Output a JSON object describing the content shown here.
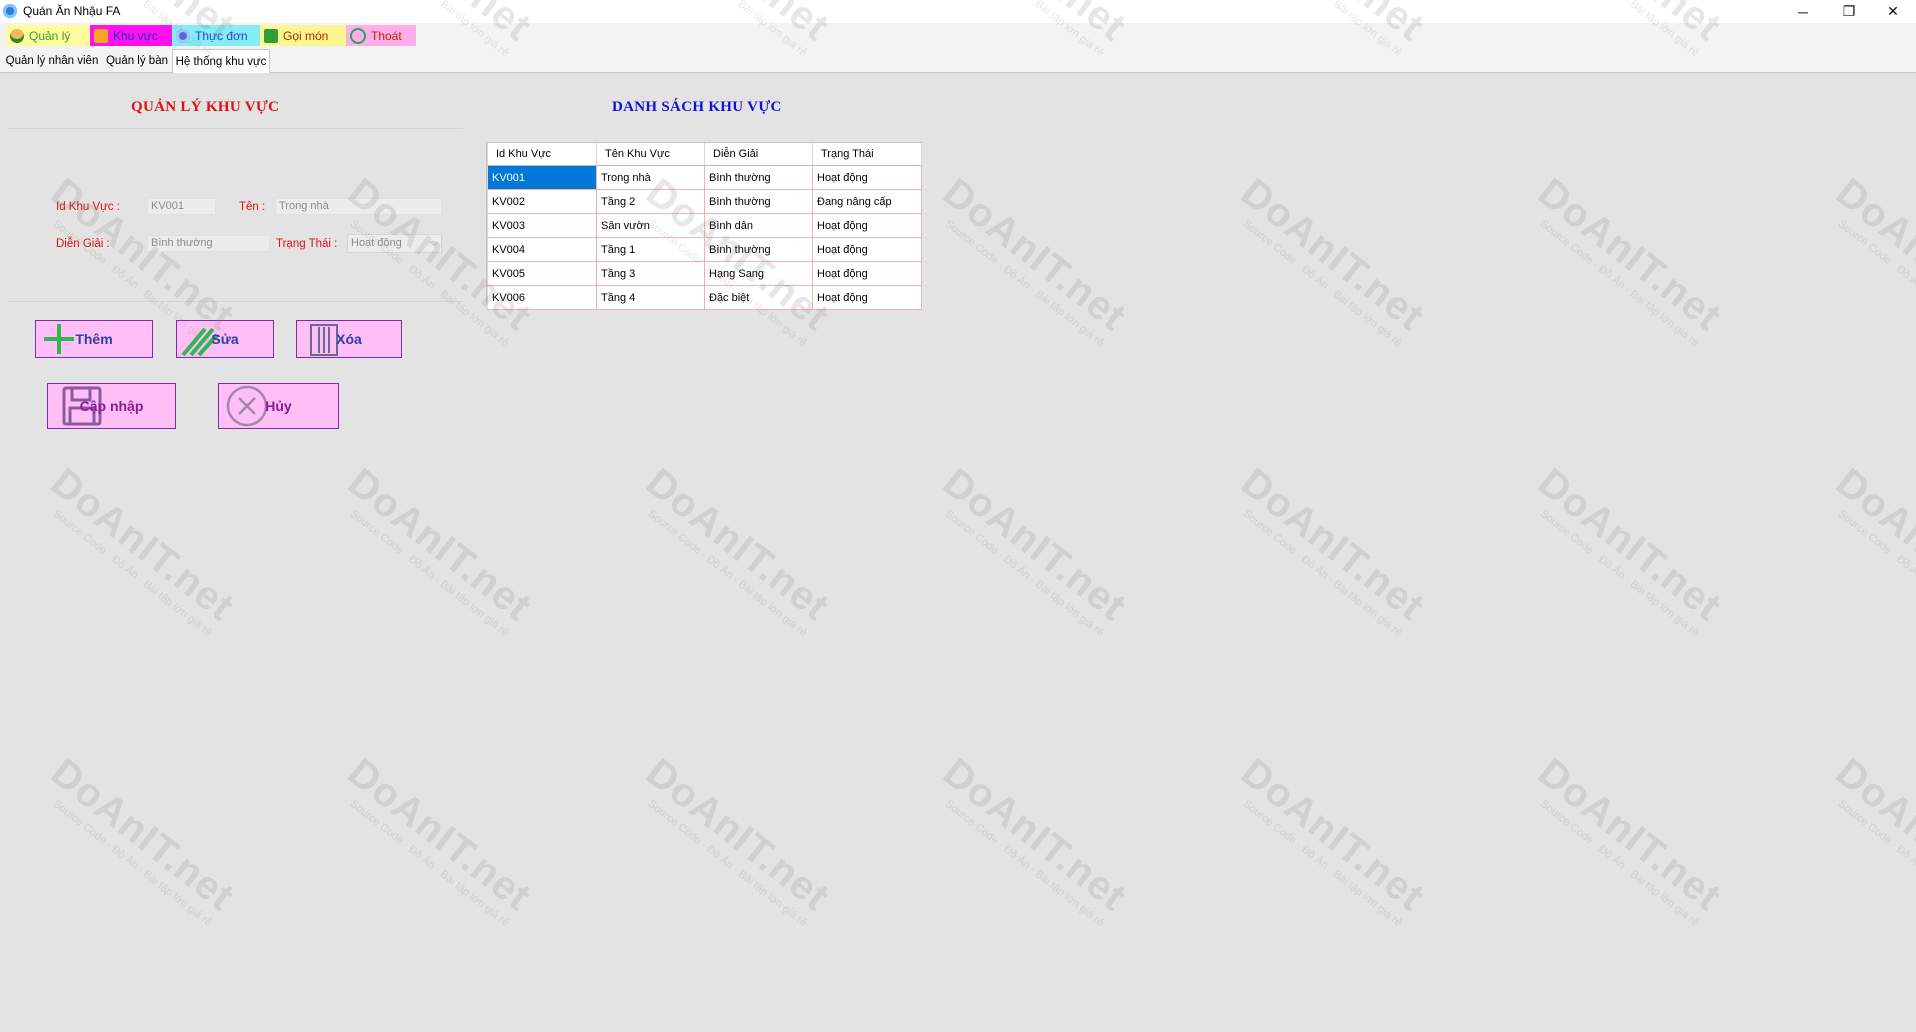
{
  "window": {
    "title": "Quán Ăn Nhậu FA",
    "minimize_glyph": "─",
    "maximize_glyph": "❐",
    "close_glyph": "✕"
  },
  "menu": [
    {
      "label": "Quản lý",
      "icon": "user-icon"
    },
    {
      "label": "Khu vực",
      "icon": "building-icon"
    },
    {
      "label": "Thực đơn",
      "icon": "menu-book-icon"
    },
    {
      "label": "Gọi món",
      "icon": "order-icon"
    },
    {
      "label": "Thoát",
      "icon": "power-icon"
    }
  ],
  "tabs": [
    "Quản lý nhân viên",
    "Quản lý bàn",
    "Hệ thống khu vực"
  ],
  "left_heading": "QUẢN LÝ  KHU VỰC",
  "right_heading": "DANH SÁCH KHU VỰC",
  "form": {
    "id_label": "Id Khu Vực :",
    "id_value": "KV001",
    "name_label": "Tên :",
    "name_value": "Trong nhà",
    "desc_label": "Diễn Giải :",
    "desc_value": "Bình thường",
    "status_label": "Trạng Thái :",
    "status_value": "Hoạt động"
  },
  "buttons": {
    "add": "Thêm",
    "edit": "Sửa",
    "delete": "Xóa",
    "update": "Cập nhập",
    "cancel": "Hủy"
  },
  "grid": {
    "columns": [
      "Id Khu Vực",
      "Tên Khu Vực",
      "Diễn Giải",
      "Trạng Thái"
    ],
    "rows": [
      [
        "KV001",
        "Trong nhà",
        "Bình thường",
        "Hoạt động"
      ],
      [
        "KV002",
        "Tầng 2",
        "Bình thường",
        "Đang nâng cấp"
      ],
      [
        "KV003",
        "Sân vườn",
        "Bình dân",
        "Hoạt động"
      ],
      [
        "KV004",
        "Tầng 1",
        "Bình thường",
        "Hoạt động"
      ],
      [
        "KV005",
        "Tầng 3",
        "Hạng Sang",
        "Hoạt động"
      ],
      [
        "KV006",
        "Tầng 4",
        "Đặc biệt",
        "Hoạt động"
      ]
    ],
    "selected_row": 0
  },
  "watermark": {
    "brand": "DoAnIT.net",
    "tagline": "Source Code · Đồ Án · Bài tập lớn giá rẻ"
  },
  "colors": {
    "heading_red": "#e01010",
    "heading_blue": "#1010d8",
    "button_bg": "#ffbef6",
    "selection": "#0078d7"
  }
}
